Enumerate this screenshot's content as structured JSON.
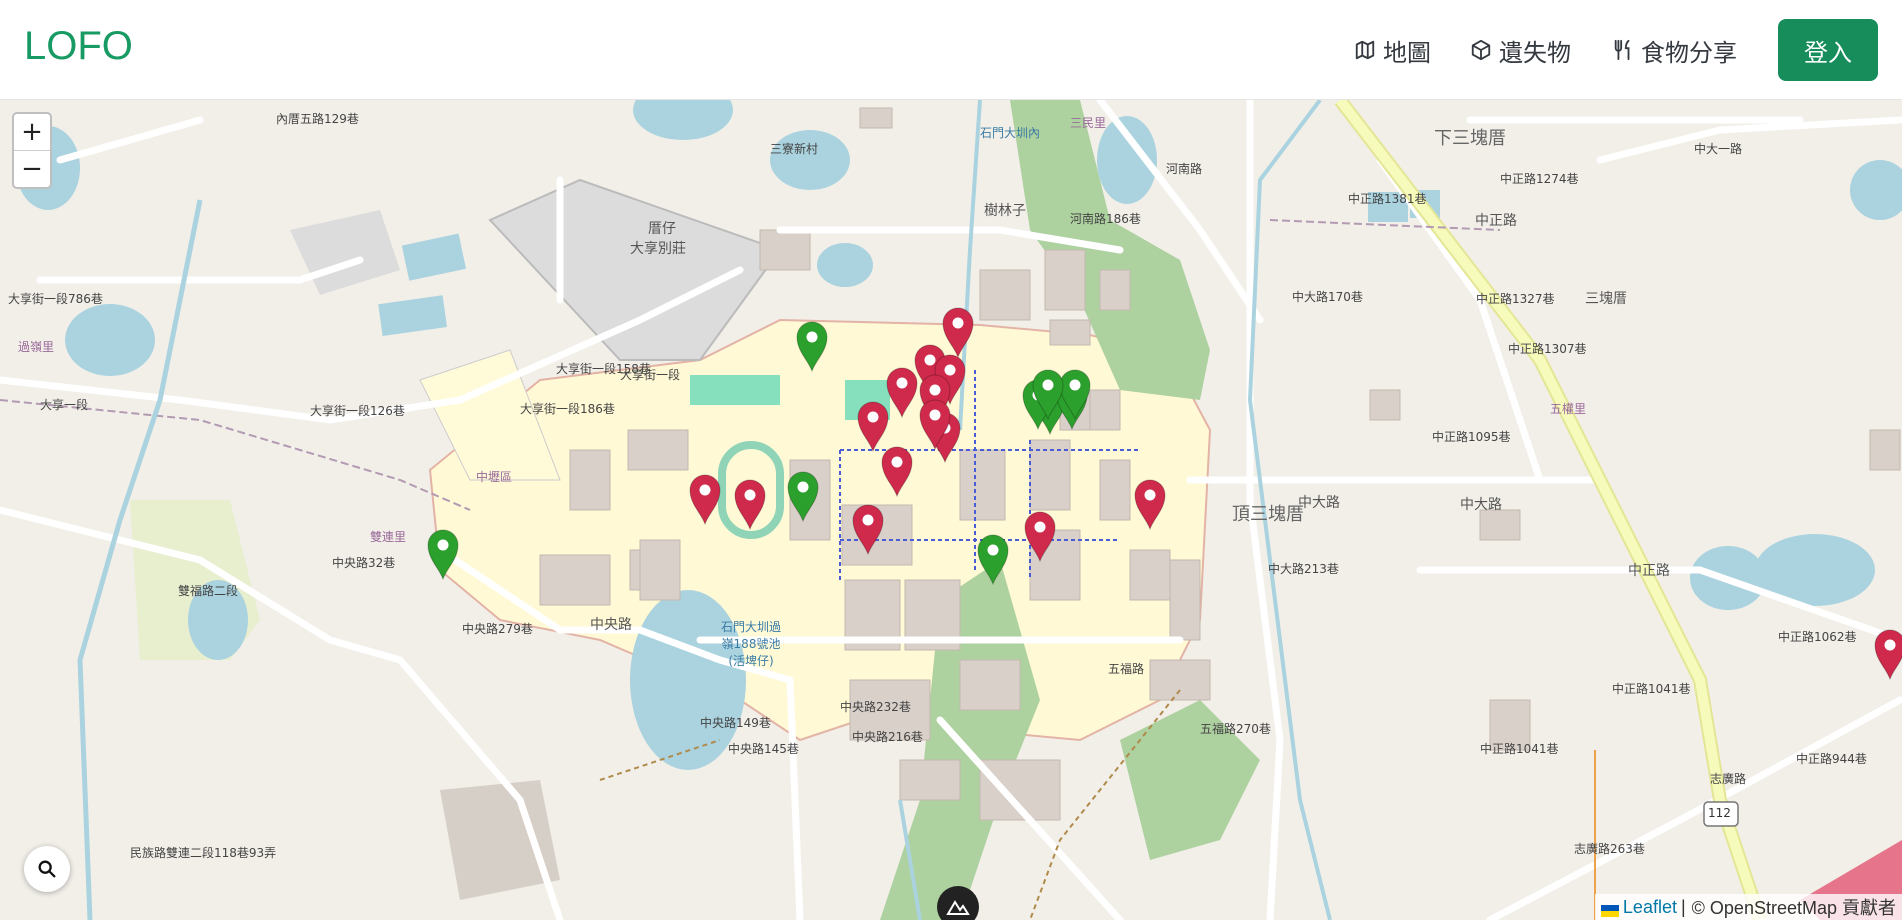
{
  "navbar": {
    "logo": "LOFO",
    "items": [
      {
        "label": "地圖",
        "icon": "map-icon"
      },
      {
        "label": "遺失物",
        "icon": "package-icon"
      },
      {
        "label": "食物分享",
        "icon": "utensils-icon"
      }
    ],
    "login_label": "登入"
  },
  "map": {
    "zoom_in": "+",
    "zoom_out": "−",
    "attribution": {
      "leaflet": "Leaflet",
      "separator": "|",
      "osm": "© OpenStreetMap 貢獻者"
    },
    "labels": [
      "下三塊厝",
      "三塊厝",
      "頂三塊厝",
      "樹林子",
      "厝仔",
      "大享別莊",
      "中大路",
      "中大路",
      "中央路",
      "中正路",
      "中正路",
      "中正路1381巷",
      "中大路170巷",
      "中正路1095巷",
      "中大路213巷",
      "中央路149巷",
      "中央路145巷",
      "中央路232巷",
      "中央路216巷",
      "中央路279巷",
      "中央路32巷",
      "雙福路二段",
      "民族路雙連二段118巷93弄",
      "大享街一段",
      "大享街一段786巷",
      "大享街一段158巷",
      "大享街一段186巷",
      "大享街一段126巷",
      "石門大圳過嶺188號池(活埤仔)",
      "河南路186巷",
      "河南路",
      "五福路",
      "五福路270巷",
      "中正路1062巷",
      "中正路1041巷",
      "中正路944巷",
      "志廣路",
      "志廣路263巷",
      "雙連里",
      "過嶺里",
      "112",
      "內厝五路129巷",
      "三寮新村",
      "石門大圳內",
      "中壢區",
      "三民里",
      "五權里",
      "中正路1327巷",
      "中正路1274巷",
      "中正路1307巷",
      "中大一路",
      "大享一段",
      "中正路1041巷"
    ],
    "markers": {
      "red_count": 15,
      "green_count": 9,
      "red_color": "#cf2a4c",
      "green_color": "#2ca02c"
    }
  }
}
